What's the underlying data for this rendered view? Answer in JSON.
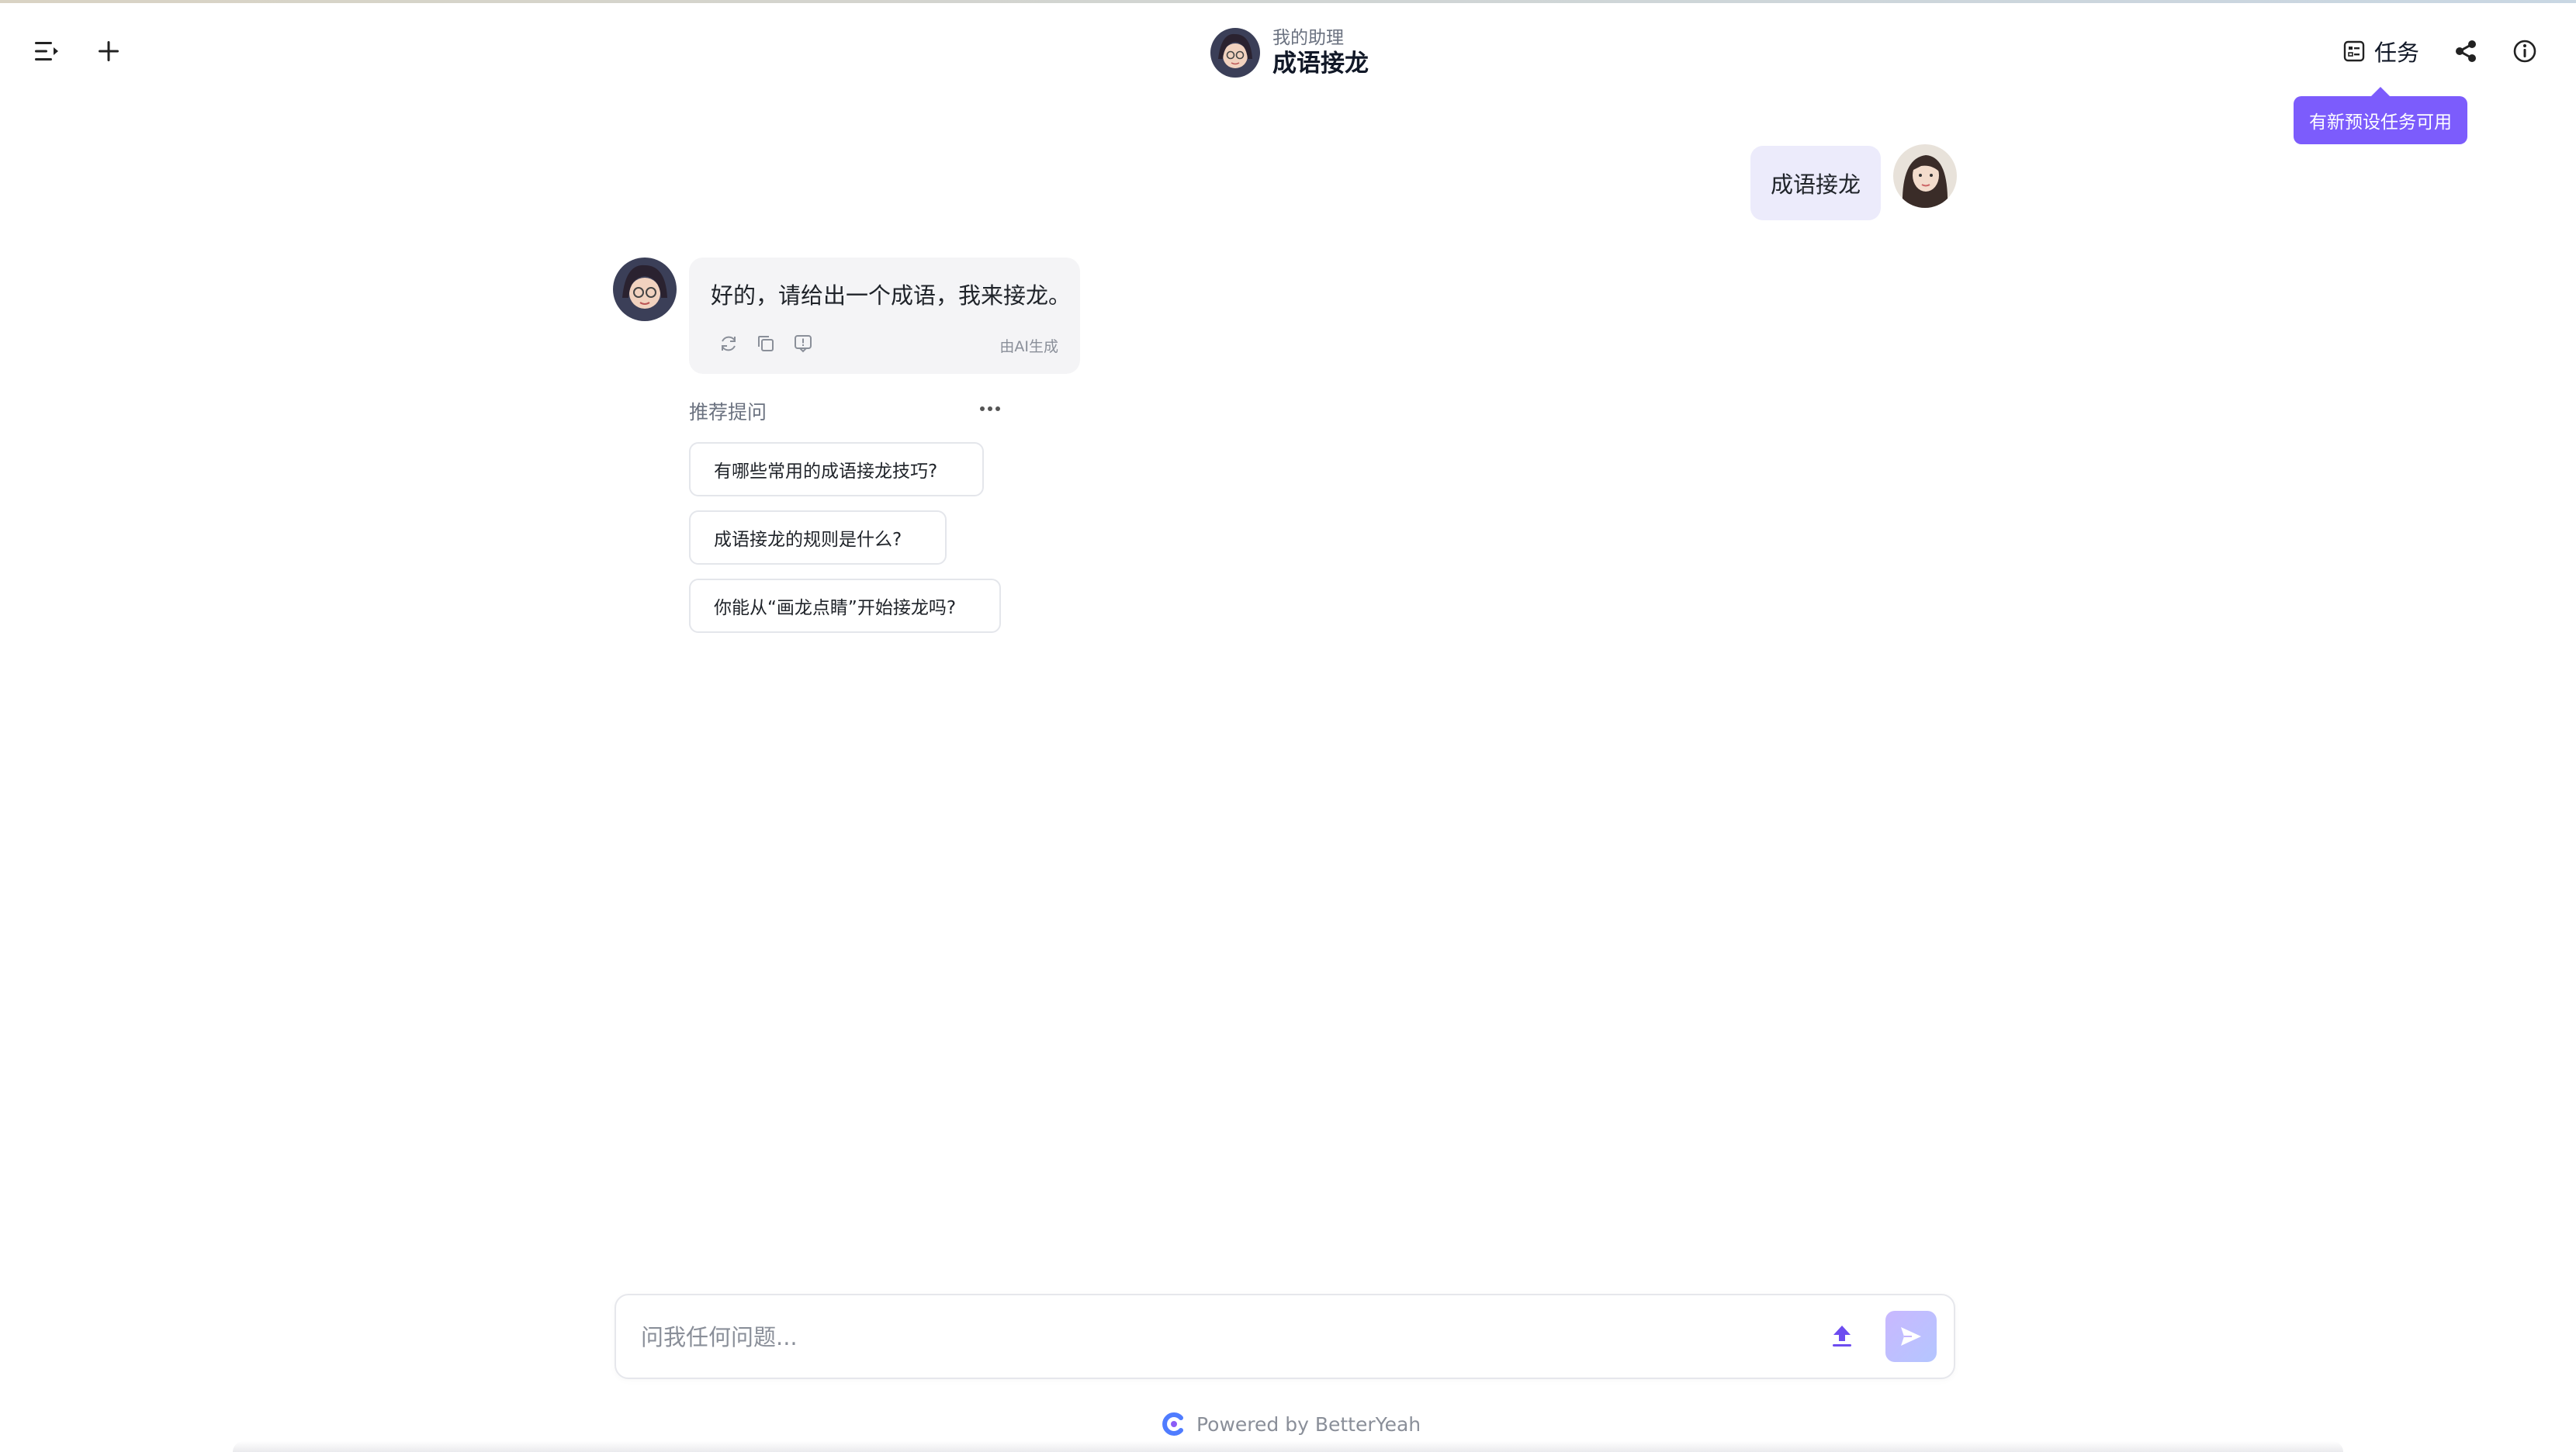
{
  "header": {
    "subtitle": "我的助理",
    "title": "成语接龙",
    "task_label": "任务",
    "tooltip": "有新预设任务可用"
  },
  "chat": {
    "user_message": "成语接龙",
    "bot_message": "好的，请给出一个成语，我来接龙。",
    "ai_tag": "由AI生成"
  },
  "recommend": {
    "title": "推荐提问",
    "items": [
      "有哪些常用的成语接龙技巧?",
      "成语接龙的规则是什么?",
      "你能从“画龙点睛”开始接龙吗?"
    ]
  },
  "input": {
    "placeholder": "问我任何问题..."
  },
  "footer": {
    "powered": "Powered by BetterYeah"
  },
  "colors": {
    "accent": "#7c5cfc",
    "user_bubble": "#ecebfb",
    "bot_bubble": "#f4f4f6"
  }
}
